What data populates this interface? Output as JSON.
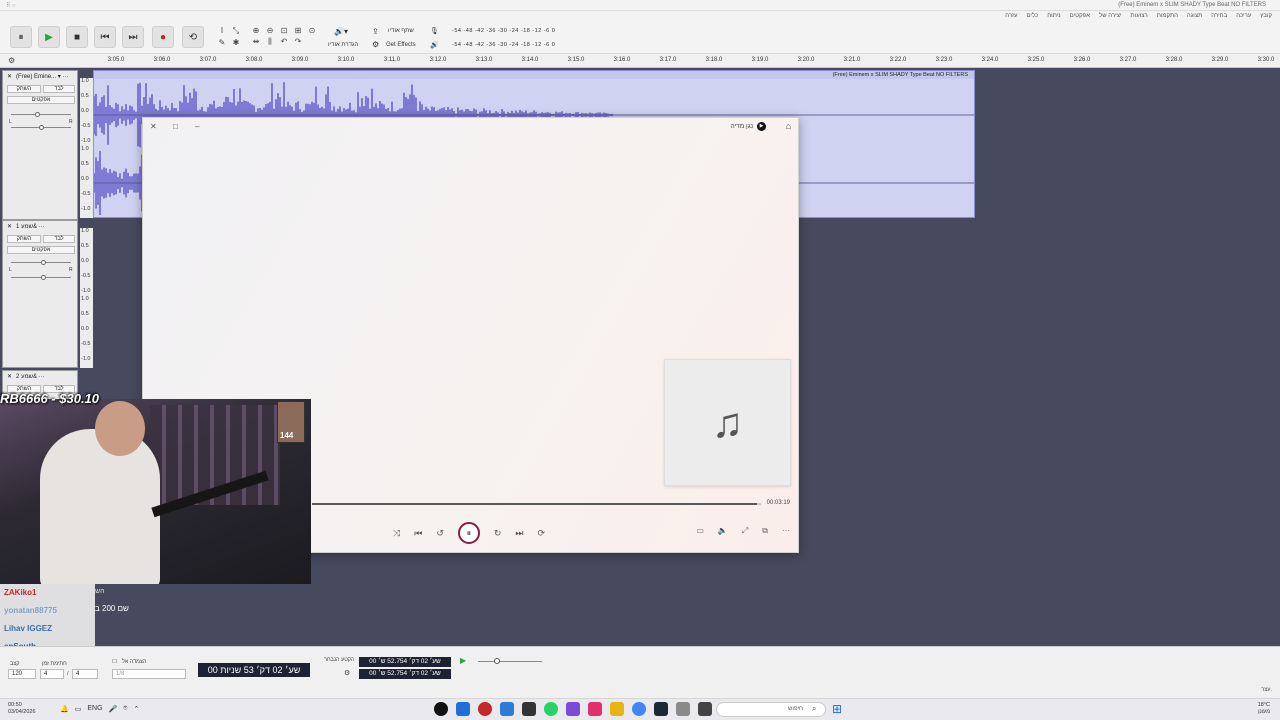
{
  "window": {
    "title": "(Free) Eminem x SLIM SHADY Type Beat NO FILTERS"
  },
  "menu": [
    "קובץ",
    "עריכה",
    "בחירה",
    "תצוגה",
    "התקמות",
    "רצועות",
    "יצירה של",
    "אפקטים",
    "ניתוח",
    "כלים",
    "עזרה"
  ],
  "toolbar": {
    "pause": "⏸",
    "play": "▶",
    "stop": "■",
    "skip_start": "⏮",
    "skip_end": "⏭",
    "record": "●",
    "loop": "⟲",
    "audio_setup_icon": "🔊▾",
    "audio_setup_label": "הגדרת אודיו",
    "share_label": "שתף אודיו",
    "effects_label": "Get Effects",
    "meter_scale": "-54 -48 -42 -36 -30 -24 -18 -12 -6 0"
  },
  "ruler": [
    "3:05.0",
    "3:06.0",
    "3:07.0",
    "3:08.0",
    "3:09.0",
    "3:10.0",
    "3:11.0",
    "3:12.0",
    "3:13.0",
    "3:14.0",
    "3:15.0",
    "3:16.0",
    "3:17.0",
    "3:18.0",
    "3:19.0",
    "3:20.0",
    "3:21.0",
    "3:22.0",
    "3:23.0",
    "3:24.0",
    "3:25.0",
    "3:26.0",
    "3:27.0",
    "3:28.0",
    "3:29.0",
    "3:30.0"
  ],
  "tracks": [
    {
      "name": "(Free) Emine...",
      "mute": "השתק",
      "solo": "לבד",
      "effects": "אפקטים",
      "clip_title": "(Free) Eminem x SLIM SHADY Type Beat NO FILTERS"
    },
    {
      "name": "שמע 1&",
      "mute": "השתק",
      "solo": "לבד",
      "effects": "אפקטים"
    },
    {
      "name": "שמע 2&",
      "mute": "השתק",
      "solo": "לבד"
    }
  ],
  "scale_labels": [
    "1.0",
    "0.5",
    "0.0",
    "-0.5",
    "-1.0"
  ],
  "player": {
    "app_name": "נגן מדיה",
    "time": "00:03:19",
    "progress": 0.99,
    "music_icon": "♫",
    "controls": {
      "shuffle": "⤨",
      "prev": "⏮",
      "rewind": "↺",
      "pause": "⏸",
      "forward": "↻",
      "next": "⏭",
      "repeat": "⟳"
    },
    "right_controls": {
      "captions": "▭",
      "volume": "🔈",
      "fullscreen": "⤢",
      "miniplayer": "⧉",
      "more": "···"
    }
  },
  "overlay": {
    "donation": "RB6666 - $30.10",
    "pip_badge": "144"
  },
  "chat": [
    {
      "user": "ZAKiko1"
    },
    {
      "user": "yonatan88775"
    },
    {
      "user": "Lihav IGGEZ"
    },
    {
      "user": "enSouth"
    }
  ],
  "chat_msg1": "הש",
  "chat_msg2": "שם 200 ב",
  "bottom": {
    "rate_label": "קצב",
    "rate": "120",
    "sig_label": "חתימת זמן",
    "sig_num": "4",
    "sig_den": "4",
    "snap_label": "הצמדה אל",
    "snap_value": "1/8",
    "time_big": "00 שע׳ 02 דק׳ 53 שניות",
    "selection_label": "הקטע הנבחר",
    "sel_start": "00 שע׳ 02 דק׳ 52.754 ש׳",
    "sel_end": "00 שע׳ 02 דק׳ 52.754 ש׳",
    "status": "עצר."
  },
  "taskbar": {
    "time": "00:50",
    "date": "03/04/2026",
    "lang": "ENG",
    "search_placeholder": "חיפוש",
    "weather_temp": "18°C",
    "weather_desc": "מעונן"
  }
}
